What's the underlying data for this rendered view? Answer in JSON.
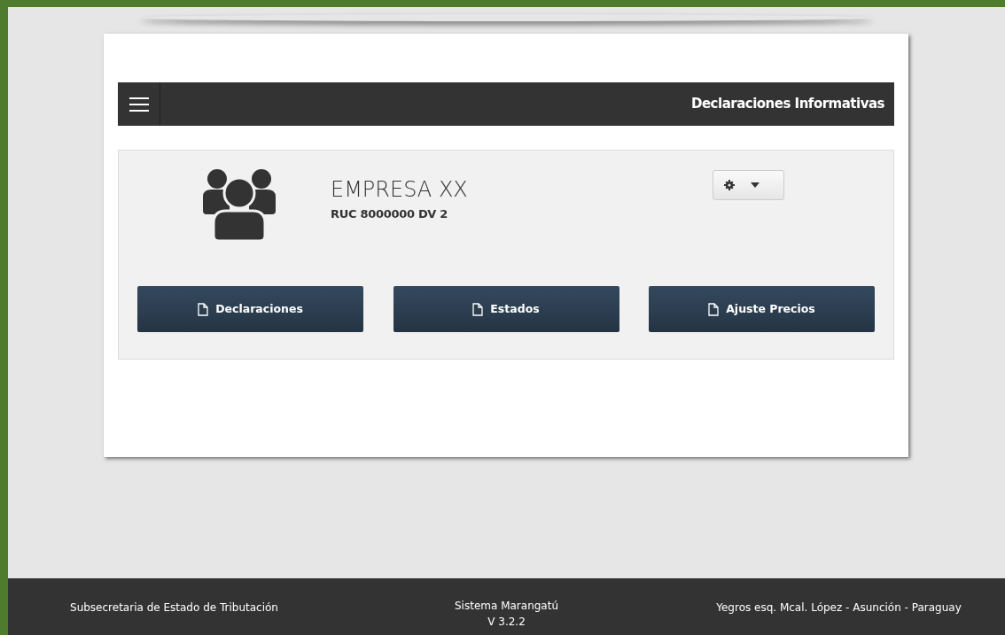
{
  "header": {
    "title": "Declaraciones Informativas"
  },
  "company": {
    "name": "EMPRESA XX",
    "ruc": "RUC 8000000 DV 2"
  },
  "actions": [
    {
      "label": "Declaraciones"
    },
    {
      "label": "Estados"
    },
    {
      "label": "Ajuste Precios"
    }
  ],
  "footer": {
    "left": "Subsecretaria de Estado de Tributación",
    "center": [
      "Sistema Marangatú",
      "V 3.2.2"
    ],
    "right": "Yegros esq. Mcal. López - Asunción - Paraguay"
  }
}
